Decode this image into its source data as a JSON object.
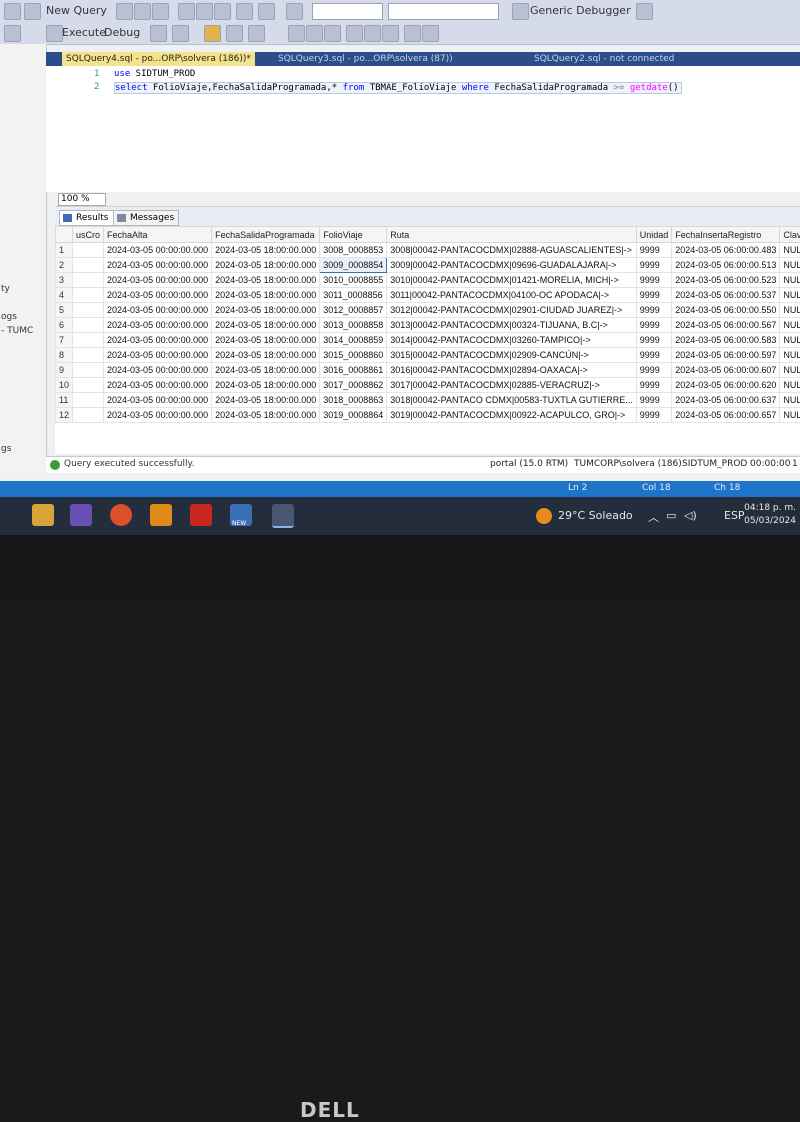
{
  "toolbar": {
    "new_query": "New Query",
    "execute": "Execute",
    "debug": "Debug",
    "debugger_combo": "Generic Debugger"
  },
  "tabs": {
    "active": "SQLQuery4.sql - po...ORP\\solvera (186))*",
    "t2": "SQLQuery3.sql - po...ORP\\solvera (87))",
    "t3": "SQLQuery2.sql - not connected"
  },
  "left_panel": {
    "l1": "ty",
    "l2": "ogs",
    "l3": "- TUMC",
    "l4": "gs"
  },
  "editor": {
    "lines": [
      "1",
      "2"
    ],
    "line1": {
      "kw": "use",
      "rest": " SIDTUM_PROD"
    },
    "line2": {
      "kw1": "select",
      "p1": " FolioViaje,FechaSalidaProgramada,* ",
      "kw2": "from",
      "p2": " TBMAE_FolioViaje ",
      "kw3": "where",
      "p3": " FechaSalidaProgramada ",
      "op": ">=",
      "sp": " ",
      "fn": "getdate",
      "end": "()"
    }
  },
  "zoom": "100 %",
  "results_tabs": {
    "results": "Results",
    "messages": "Messages"
  },
  "grid": {
    "columns": [
      "",
      "usCro",
      "FechaAlta",
      "FechaSalidaProgramada",
      "FolioViaje",
      "Ruta",
      "Unidad",
      "FechaInsertaRegistro",
      "Clave"
    ],
    "rows": [
      [
        "1",
        "",
        "2024-03-05 00:00:00.000",
        "2024-03-05 18:00:00.000",
        "3008_0008853",
        "3008|00042-PANTACOCDMX|02888-AGUASCALIENTES|->",
        "9999",
        "2024-03-05 06:00:00.483",
        "NUL"
      ],
      [
        "2",
        "",
        "2024-03-05 00:00:00.000",
        "2024-03-05 18:00:00.000",
        "3009_0008854",
        "3009|00042-PANTACOCDMX|09696-GUADALAJARA|->",
        "9999",
        "2024-03-05 06:00:00.513",
        "NUL"
      ],
      [
        "3",
        "",
        "2024-03-05 00:00:00.000",
        "2024-03-05 18:00:00.000",
        "3010_0008855",
        "3010|00042-PANTACOCDMX|01421-MORELIA, MICH|->",
        "9999",
        "2024-03-05 06:00:00.523",
        "NUL"
      ],
      [
        "4",
        "",
        "2024-03-05 00:00:00.000",
        "2024-03-05 18:00:00.000",
        "3011_0008856",
        "3011|00042-PANTACOCDMX|04100-OC APODACA|->",
        "9999",
        "2024-03-05 06:00:00.537",
        "NUL"
      ],
      [
        "5",
        "",
        "2024-03-05 00:00:00.000",
        "2024-03-05 18:00:00.000",
        "3012_0008857",
        "3012|00042-PANTACOCDMX|02901-CIUDAD JUAREZ|->",
        "9999",
        "2024-03-05 06:00:00.550",
        "NUL"
      ],
      [
        "6",
        "",
        "2024-03-05 00:00:00.000",
        "2024-03-05 18:00:00.000",
        "3013_0008858",
        "3013|00042-PANTACOCDMX|00324-TIJUANA, B.C|->",
        "9999",
        "2024-03-05 06:00:00.567",
        "NUL"
      ],
      [
        "7",
        "",
        "2024-03-05 00:00:00.000",
        "2024-03-05 18:00:00.000",
        "3014_0008859",
        "3014|00042-PANTACOCDMX|03260-TAMPICO|->",
        "9999",
        "2024-03-05 06:00:00.583",
        "NUL"
      ],
      [
        "8",
        "",
        "2024-03-05 00:00:00.000",
        "2024-03-05 18:00:00.000",
        "3015_0008860",
        "3015|00042-PANTACOCDMX|02909-CANCÚN|->",
        "9999",
        "2024-03-05 06:00:00.597",
        "NUL"
      ],
      [
        "9",
        "",
        "2024-03-05 00:00:00.000",
        "2024-03-05 18:00:00.000",
        "3016_0008861",
        "3016|00042-PANTACOCDMX|02894-OAXACA|->",
        "9999",
        "2024-03-05 06:00:00.607",
        "NUL"
      ],
      [
        "10",
        "",
        "2024-03-05 00:00:00.000",
        "2024-03-05 18:00:00.000",
        "3017_0008862",
        "3017|00042-PANTACOCDMX|02885-VERACRUZ|->",
        "9999",
        "2024-03-05 06:00:00.620",
        "NUL"
      ],
      [
        "11",
        "",
        "2024-03-05 00:00:00.000",
        "2024-03-05 18:00:00.000",
        "3018_0008863",
        "3018|00042-PANTACO CDMX|00583-TUXTLA GUTIERRE...",
        "9999",
        "2024-03-05 06:00:00.637",
        "NUL"
      ],
      [
        "12",
        "",
        "2024-03-05 00:00:00.000",
        "2024-03-05 18:00:00.000",
        "3019_0008864",
        "3019|00042-PANTACOCDMX|00922-ACAPULCO, GRO|->",
        "9999",
        "2024-03-05 06:00:00.657",
        "NUL"
      ]
    ]
  },
  "status": {
    "message": "Query executed successfully.",
    "server": "portal (15.0 RTM)",
    "user": "TUMCORP\\solvera (186)",
    "db": "SIDTUM_PROD",
    "time": "00:00:00",
    "rows": "1"
  },
  "ssms_status": {
    "ln": "Ln 2",
    "col": "Col 18",
    "ch": "Ch 18"
  },
  "taskbar": {
    "weather": "29°C  Soleado",
    "lang": "ESP",
    "time": "04:18 p. m.",
    "date": "05/03/2024",
    "new_badge": "NEW"
  },
  "brand": "DELL",
  "colors": {
    "accent": "#1e74c9",
    "ok": "#3c9c3c",
    "tab_active": "#f3e38c"
  }
}
